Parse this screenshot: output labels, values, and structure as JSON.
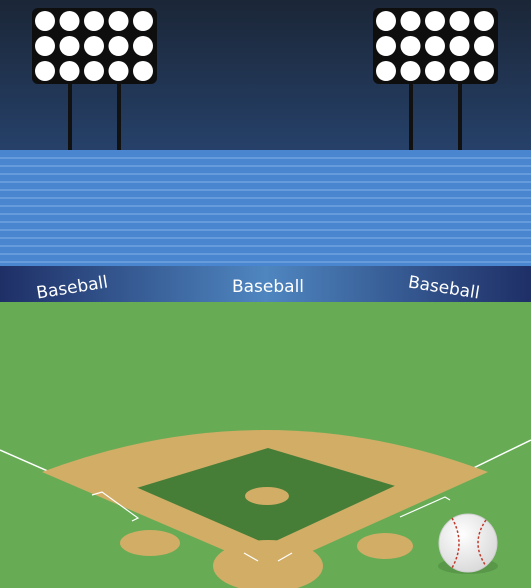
{
  "scene": {
    "banners": [
      {
        "text": "Baseball"
      },
      {
        "text": "Baseball"
      },
      {
        "text": "Baseball"
      }
    ],
    "light_towers": 2,
    "lamps_per_tower": {
      "rows": 3,
      "cols": 5
    },
    "colors": {
      "sky_top": "#1c2b3f",
      "sky_bottom": "#243a5e",
      "stands": "#4a86cf",
      "stand_line": "#7fb0ea",
      "banner_dark": "#1c2f63",
      "banner_light": "#3f6fae",
      "grass": "#67ac55",
      "infield_grass": "#467e38",
      "dirt": "#d2ad66",
      "chalk": "#ffffff",
      "ball": "#f4f4f4",
      "stitch": "#c0392b"
    }
  }
}
